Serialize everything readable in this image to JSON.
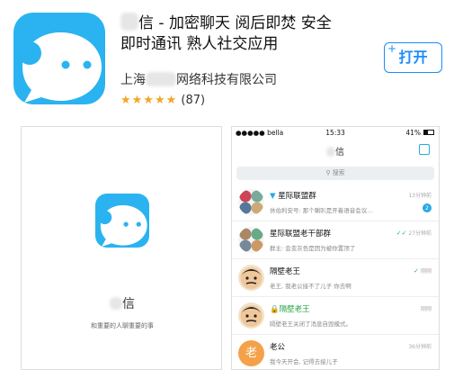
{
  "app": {
    "title_line1": "信 - 加密聊天 阅后即焚 安全",
    "title_line2": "即时通讯 熟人社交应用",
    "developer_prefix": "上海",
    "developer_suffix": "网络科技有限公司",
    "stars": "★★★★★",
    "rating_count": "(87)",
    "get_label": "打开",
    "get_plus": "+"
  },
  "screenshot1": {
    "app_name": "信",
    "slogan": "和重要的人聊重要的事"
  },
  "screenshot2": {
    "status": {
      "carrier": "●●●●● bella",
      "time": "15:33",
      "battery": "41%"
    },
    "nav_title": "信",
    "search_placeholder": "搜索",
    "chats": [
      {
        "name": "星际联盟群",
        "message": "休伯利安号: 那个喇叭是开着语音会议...",
        "time": "13分钟前",
        "badge": "2"
      },
      {
        "name": "星际联盟老干部群",
        "message": "群主: 会变灰色是因为被你置顶了",
        "time": "27分钟前"
      },
      {
        "name": "隔壁老王",
        "message": "老王, 我老公接不了儿子 你去啊",
        "time": "刚刚"
      },
      {
        "name": "隔壁老王",
        "message": "隔壁老王关闭了消息自毁模式。",
        "time": "刚刚"
      },
      {
        "name": "老公",
        "message": "我今天开会, 记得去接儿子",
        "time": "36分钟前",
        "avatar_text": "老"
      }
    ]
  },
  "colors": {
    "brand": "#2ab3f0",
    "link": "#1a8cff",
    "star": "#f4a623"
  }
}
